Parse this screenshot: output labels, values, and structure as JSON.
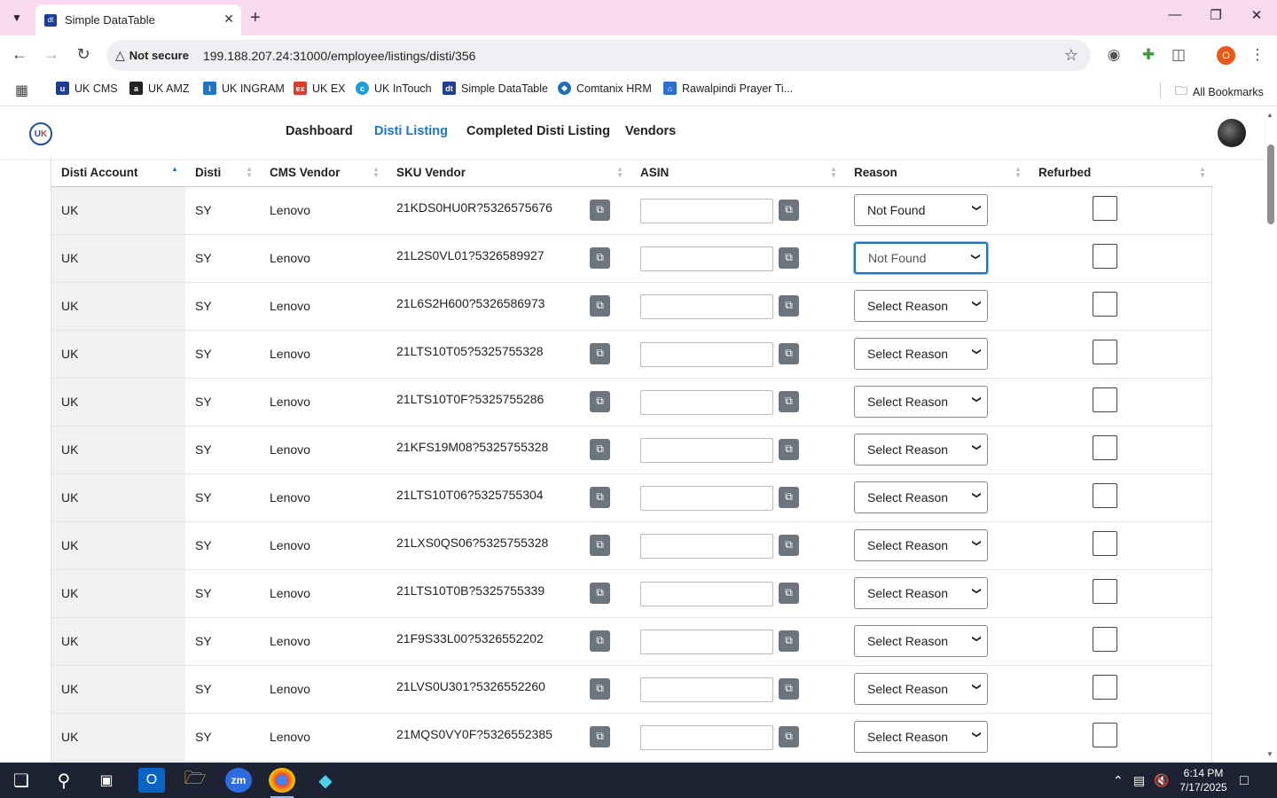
{
  "browser": {
    "tab_title": "Simple DataTable",
    "tab_favicon_text": "dt",
    "security_label": "Not secure",
    "url": "199.188.207.24:31000/employee/listings/disti/356",
    "profile_initial": "O",
    "all_bookmarks_label": "All Bookmarks",
    "bookmarks": [
      {
        "label": "UK CMS",
        "icon": "uk-cms-icon",
        "color": "#1c3f95"
      },
      {
        "label": "UK AMZ",
        "icon": "amazon-icon",
        "color": "#222222"
      },
      {
        "label": "UK INGRAM",
        "icon": "ingram-icon",
        "color": "#1d74c7"
      },
      {
        "label": "UK EX",
        "icon": "ex-icon",
        "color": "#e03a2b"
      },
      {
        "label": "UK InTouch",
        "icon": "intouch-icon",
        "color": "#1d9fd6"
      },
      {
        "label": "Simple DataTable",
        "icon": "datatable-icon",
        "color": "#1c3f95"
      },
      {
        "label": "Comtanix HRM",
        "icon": "hrm-icon",
        "color": "#1e6fb8"
      },
      {
        "label": "Rawalpindi Prayer Ti...",
        "icon": "prayer-icon",
        "color": "#2d6fd0"
      }
    ]
  },
  "nav": {
    "links": [
      "Dashboard",
      "Disti Listing",
      "Completed Disti Listing",
      "Vendors"
    ],
    "active": "Disti Listing"
  },
  "table": {
    "columns": [
      "Disti Account",
      "Disti",
      "CMS Vendor",
      "SKU Vendor",
      "ASIN",
      "Reason",
      "Refurbed"
    ],
    "rows": [
      {
        "account": "UK",
        "disti": "SY",
        "vendor": "Lenovo",
        "sku": "21KDS0HU0R?5326575676",
        "asin": "",
        "reason": "Not Found",
        "refurbed": false
      },
      {
        "account": "UK",
        "disti": "SY",
        "vendor": "Lenovo",
        "sku": "21L2S0VL01?5326589927",
        "asin": "",
        "reason": "Not Found",
        "refurbed": false
      },
      {
        "account": "UK",
        "disti": "SY",
        "vendor": "Lenovo",
        "sku": "21L6S2H600?5326586973",
        "asin": "",
        "reason": "Select Reason",
        "refurbed": false
      },
      {
        "account": "UK",
        "disti": "SY",
        "vendor": "Lenovo",
        "sku": "21LTS10T05?5325755328",
        "asin": "",
        "reason": "Select Reason",
        "refurbed": false
      },
      {
        "account": "UK",
        "disti": "SY",
        "vendor": "Lenovo",
        "sku": "21LTS10T0F?5325755286",
        "asin": "",
        "reason": "Select Reason",
        "refurbed": false
      },
      {
        "account": "UK",
        "disti": "SY",
        "vendor": "Lenovo",
        "sku": "21KFS19M08?5325755328",
        "asin": "",
        "reason": "Select Reason",
        "refurbed": false
      },
      {
        "account": "UK",
        "disti": "SY",
        "vendor": "Lenovo",
        "sku": "21LTS10T06?5325755304",
        "asin": "",
        "reason": "Select Reason",
        "refurbed": false
      },
      {
        "account": "UK",
        "disti": "SY",
        "vendor": "Lenovo",
        "sku": "21LXS0QS06?5325755328",
        "asin": "",
        "reason": "Select Reason",
        "refurbed": false
      },
      {
        "account": "UK",
        "disti": "SY",
        "vendor": "Lenovo",
        "sku": "21LTS10T0B?5325755339",
        "asin": "",
        "reason": "Select Reason",
        "refurbed": false
      },
      {
        "account": "UK",
        "disti": "SY",
        "vendor": "Lenovo",
        "sku": "21F9S33L00?5326552202",
        "asin": "",
        "reason": "Select Reason",
        "refurbed": false
      },
      {
        "account": "UK",
        "disti": "SY",
        "vendor": "Lenovo",
        "sku": "21LVS0U301?5326552260",
        "asin": "",
        "reason": "Select Reason",
        "refurbed": false
      },
      {
        "account": "UK",
        "disti": "SY",
        "vendor": "Lenovo",
        "sku": "21MQS0VY0F?5326552385",
        "asin": "",
        "reason": "Select Reason",
        "refurbed": false
      }
    ]
  },
  "taskbar": {
    "time": "6:14 PM",
    "date": "7/17/2025"
  }
}
